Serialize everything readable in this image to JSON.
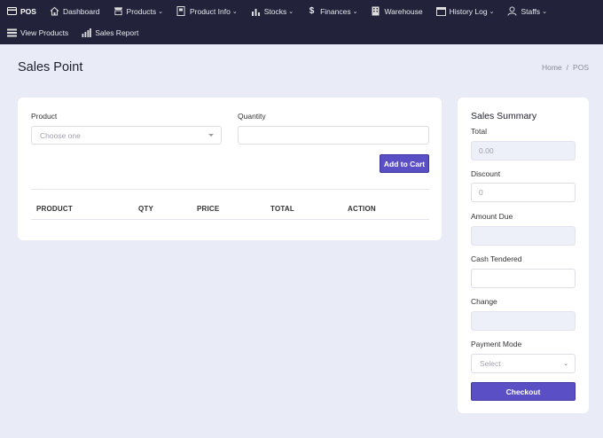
{
  "nav": {
    "row1": [
      {
        "label": "POS",
        "icon": "card-icon",
        "dropdown": false,
        "active": true
      },
      {
        "label": "Dashboard",
        "icon": "home-icon",
        "dropdown": false
      },
      {
        "label": "Products",
        "icon": "store-icon",
        "dropdown": true
      },
      {
        "label": "Product Info",
        "icon": "book-icon",
        "dropdown": true
      },
      {
        "label": "Stocks",
        "icon": "bar-chart-icon",
        "dropdown": true
      },
      {
        "label": "Finances",
        "icon": "dollar-icon",
        "dropdown": true
      },
      {
        "label": "Warehouse",
        "icon": "building-icon",
        "dropdown": false
      },
      {
        "label": "History Log",
        "icon": "calendar-icon",
        "dropdown": true
      },
      {
        "label": "Staffs",
        "icon": "user-icon",
        "dropdown": true
      }
    ],
    "row2": [
      {
        "label": "View Products",
        "icon": "list-icon"
      },
      {
        "label": "Sales Report",
        "icon": "report-icon"
      }
    ]
  },
  "page": {
    "title": "Sales Point",
    "breadcrumb": [
      "Home",
      "POS"
    ]
  },
  "form": {
    "product_label": "Product",
    "product_placeholder": "Choose one",
    "quantity_label": "Quantity",
    "quantity_value": "",
    "add_button": "Add to Cart"
  },
  "table": {
    "columns": [
      "PRODUCT",
      "QTY",
      "PRICE",
      "TOTAL",
      "ACTION"
    ],
    "rows": []
  },
  "summary": {
    "title": "Sales Summary",
    "total_label": "Total",
    "total_value": "0.00",
    "discount_label": "Discount",
    "discount_value": "0",
    "amount_due_label": "Amount Due",
    "amount_due_value": "",
    "cash_tendered_label": "Cash Tendered",
    "cash_tendered_value": "",
    "change_label": "Change",
    "change_value": "",
    "payment_mode_label": "Payment Mode",
    "payment_mode_value": "Select",
    "checkout_button": "Checkout"
  },
  "colors": {
    "nav_bg": "#22223a",
    "page_bg": "#e9ebf6",
    "accent": "#5a4fc4"
  }
}
